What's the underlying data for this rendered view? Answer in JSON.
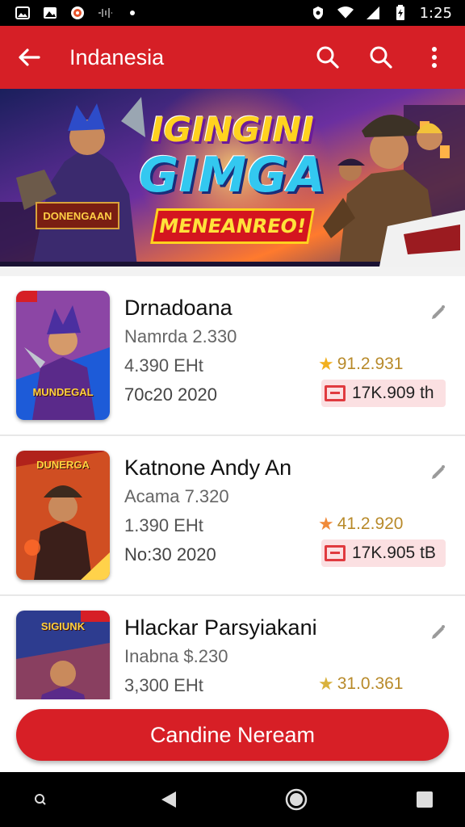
{
  "status_bar": {
    "time": "1:25",
    "icons": [
      "gallery-icon",
      "photo-icon",
      "record-icon",
      "signal-bars-icon",
      "dot-icon"
    ],
    "right_icons": [
      "vpn-icon",
      "wifi-icon",
      "signal-icon",
      "battery-icon"
    ]
  },
  "app_bar": {
    "title": "Indanesia",
    "icons": [
      "back-arrow-icon",
      "search-icon",
      "search-icon",
      "more-vertical-icon"
    ]
  },
  "banner": {
    "line1": "IGINGINI",
    "line2": "GIMGA",
    "line3": "MENEANREO!",
    "side_label": "DONENGAAN",
    "colors": {
      "sky": "#2b2f7a",
      "accent": "#ff7a2d",
      "title_yellow": "#ffd21f",
      "title_cyan": "#33c8f0"
    }
  },
  "items": [
    {
      "title": "Drnadoana",
      "subtitle": "Namrda 2.330",
      "size": "4.390 EHt",
      "date": "70c20 2020",
      "rating": "91.2.931",
      "price": "17K.909 th",
      "thumb_caption": "MUNDEGAL",
      "thumb_colors": [
        "#1d5bd8",
        "#e7347c",
        "#f3c14d"
      ]
    },
    {
      "title": "Katnone Andy An",
      "subtitle": "Acama 7.320",
      "size": "1.390 EHt",
      "date": "No:30 2020",
      "rating": "41.2.920",
      "price": "17K.905 tB",
      "thumb_caption": "DUNERGA",
      "thumb_colors": [
        "#b1221b",
        "#f07a2a",
        "#ffd24a"
      ]
    },
    {
      "title": "Hlackar Parsyiakani",
      "subtitle": "Inabna $.230",
      "size": "3,300 EHt",
      "date": "",
      "rating": "31.0.361",
      "price": "",
      "thumb_caption": "SIGIUNK",
      "thumb_colors": [
        "#2d3c8f",
        "#d5423a",
        "#ffd24a"
      ]
    }
  ],
  "cta": {
    "label": "Candine Neream"
  },
  "nav_bar": {
    "icons": [
      "assistant-icon",
      "back-triangle-icon",
      "home-circle-icon",
      "recents-square-icon"
    ]
  },
  "theme": {
    "primary": "#d61f26",
    "chip_bg": "#fbe0e2",
    "star": "#f2b01e"
  }
}
